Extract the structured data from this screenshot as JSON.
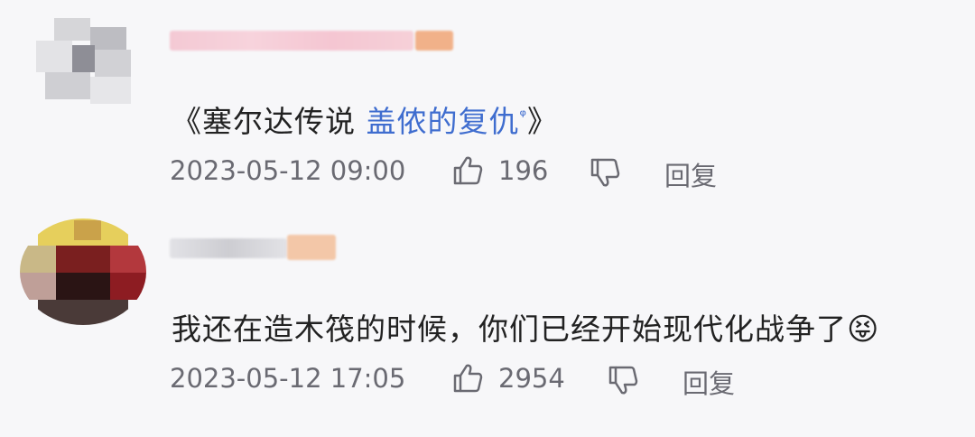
{
  "comments": [
    {
      "text_prefix": "《塞尔达传说 ",
      "link_text": "盖侬的复仇",
      "link_marker": "ᵠ",
      "text_suffix": "》",
      "timestamp": "2023-05-12 09:00",
      "likes": "196",
      "reply_label": "回复"
    },
    {
      "text": "我还在造木筏的时候，你们已经开始现代化战争了",
      "emoji": "😝",
      "timestamp": "2023-05-12 17:05",
      "likes": "2954",
      "reply_label": "回复"
    }
  ],
  "icons": {
    "like": "thumbs-up-icon",
    "dislike": "thumbs-down-icon",
    "search_marker": "search-icon"
  },
  "colors": {
    "background": "#f7f7f9",
    "text": "#222222",
    "meta": "#6a6a72",
    "link": "#3f6dcf"
  }
}
